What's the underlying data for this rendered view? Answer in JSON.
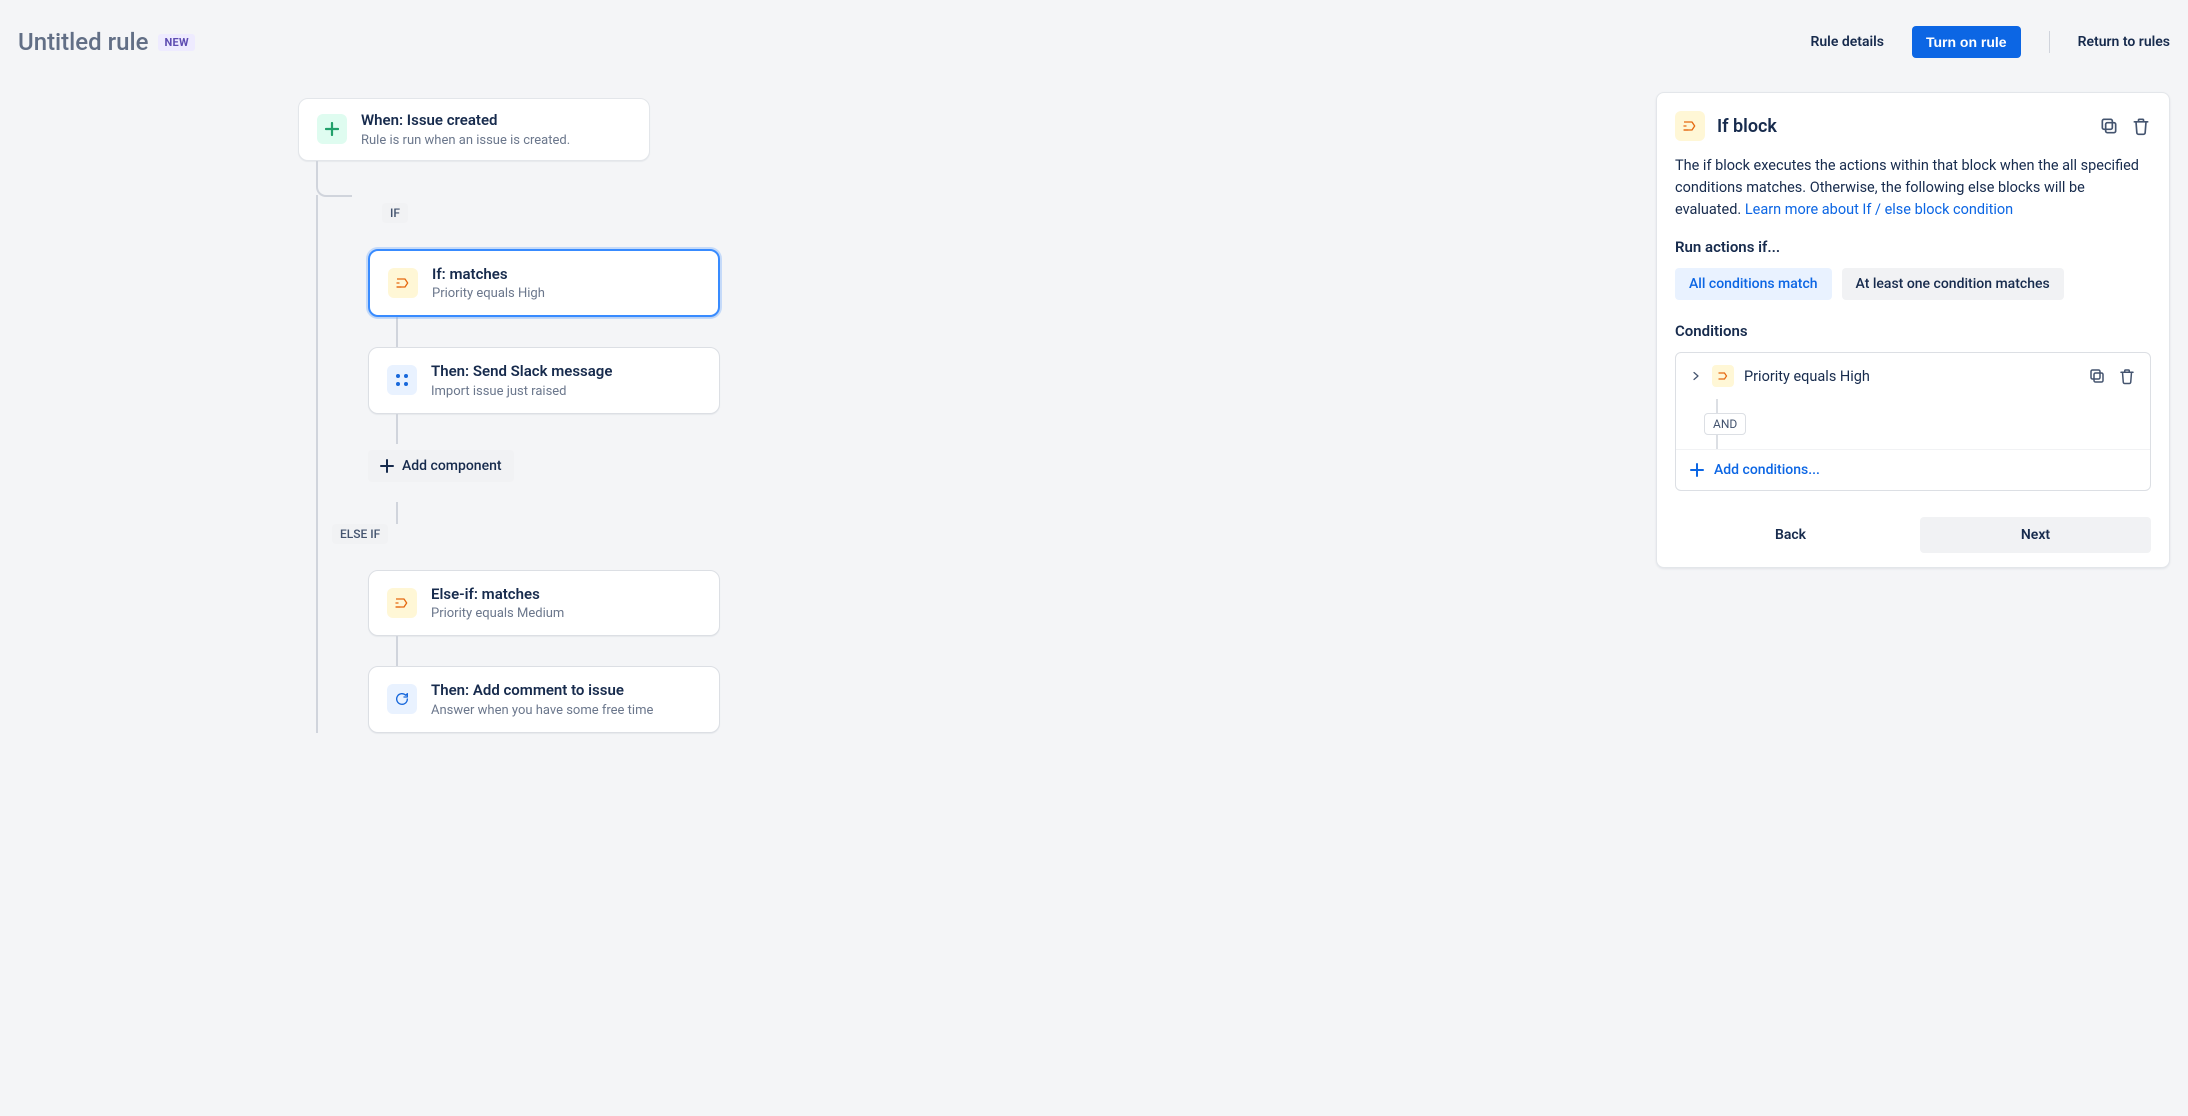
{
  "header": {
    "title": "Untitled rule",
    "badge": "NEW",
    "rule_details": "Rule details",
    "turn_on": "Turn on rule",
    "return": "Return to rules"
  },
  "flow": {
    "trigger": {
      "title": "When: Issue created",
      "subtitle": "Rule is run when an issue is created."
    },
    "if_label": "IF",
    "if_node": {
      "title": "If: matches",
      "subtitle": "Priority equals High"
    },
    "then_slack": {
      "title": "Then: Send Slack message",
      "subtitle": "Import issue just raised"
    },
    "add_component": "Add component",
    "elseif_label": "ELSE IF",
    "elseif_node": {
      "title": "Else-if: matches",
      "subtitle": "Priority equals Medium"
    },
    "then_comment": {
      "title": "Then: Add comment to issue",
      "subtitle": "Answer when you have some free time"
    }
  },
  "panel": {
    "title": "If block",
    "desc_text": "The if block executes the actions within that block when the all specified conditions matches. Otherwise, the following else blocks will be evaluated. ",
    "learn_more": "Learn more about If / else block condition",
    "run_actions_if": "Run actions if...",
    "choice_all": "All conditions match",
    "choice_one": "At least one condition matches",
    "conditions_title": "Conditions",
    "condition_text": "Priority equals High",
    "and_label": "AND",
    "add_conditions": "Add conditions...",
    "back": "Back",
    "next": "Next"
  }
}
